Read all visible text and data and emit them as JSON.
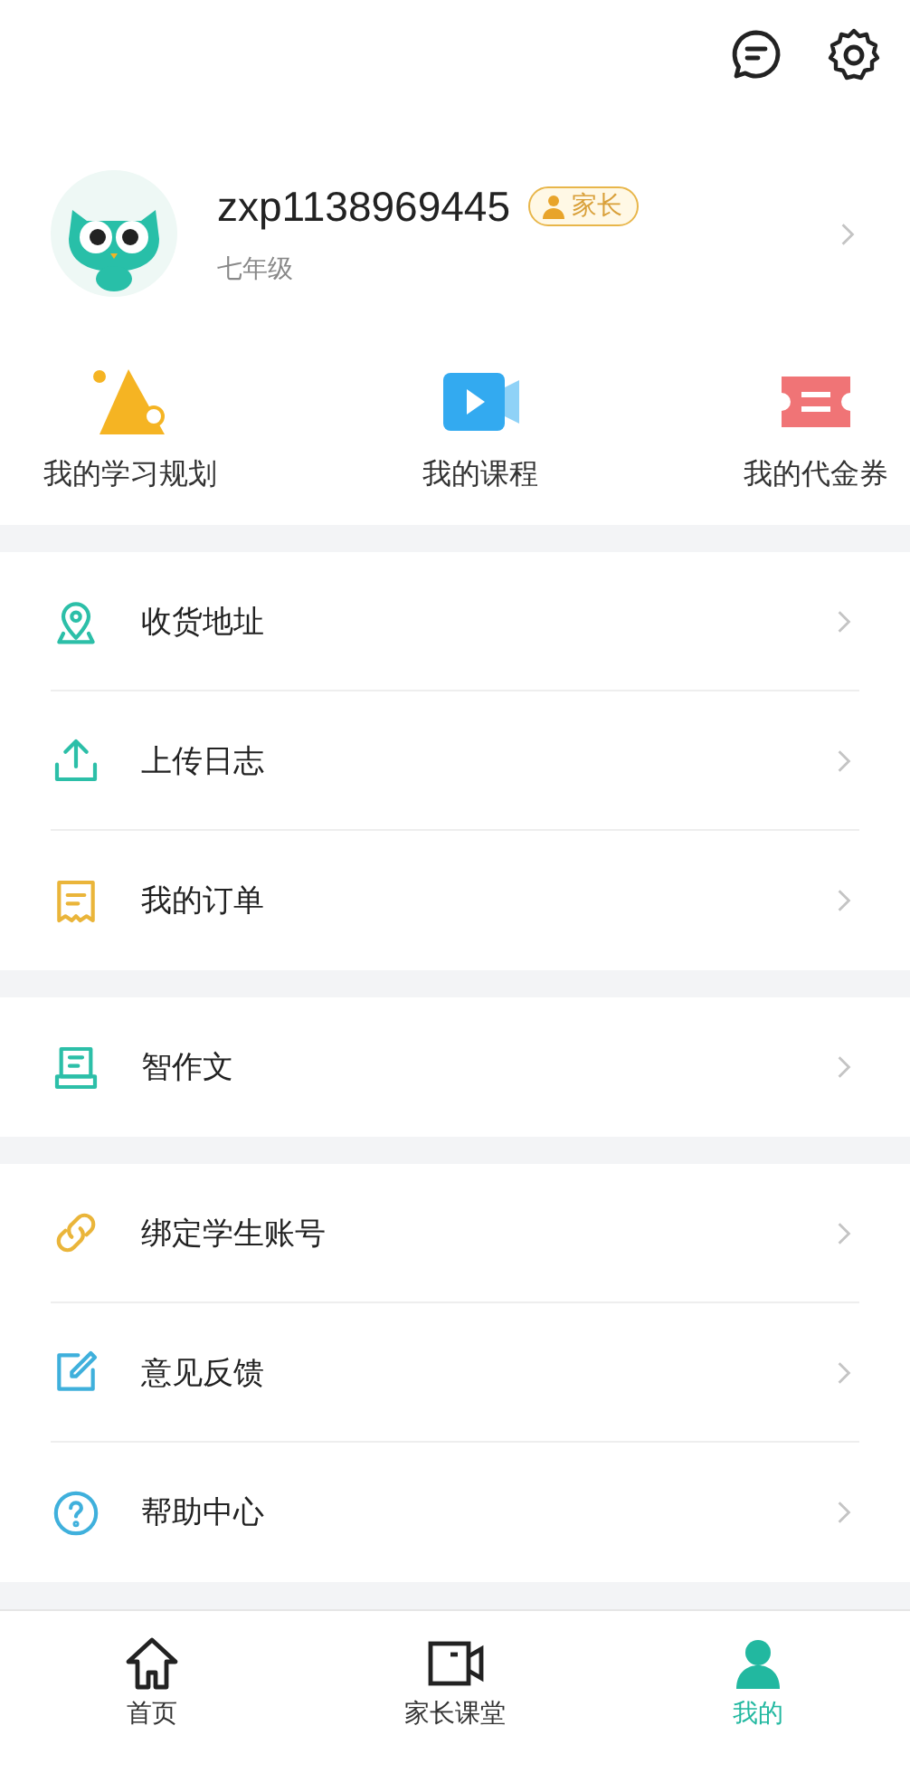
{
  "profile": {
    "username": "zxp1138969445",
    "role_badge": "家长",
    "grade": "七年级"
  },
  "shortcuts": [
    {
      "label": "我的学习规划"
    },
    {
      "label": "我的课程"
    },
    {
      "label": "我的代金券"
    }
  ],
  "menu_groups": [
    [
      {
        "label": "收货地址"
      },
      {
        "label": "上传日志"
      },
      {
        "label": "我的订单"
      }
    ],
    [
      {
        "label": "智作文"
      }
    ],
    [
      {
        "label": "绑定学生账号"
      },
      {
        "label": "意见反馈"
      },
      {
        "label": "帮助中心"
      }
    ]
  ],
  "tabs": [
    {
      "label": "首页",
      "selected": false
    },
    {
      "label": "家长课堂",
      "selected": false
    },
    {
      "label": "我的",
      "selected": true
    }
  ]
}
